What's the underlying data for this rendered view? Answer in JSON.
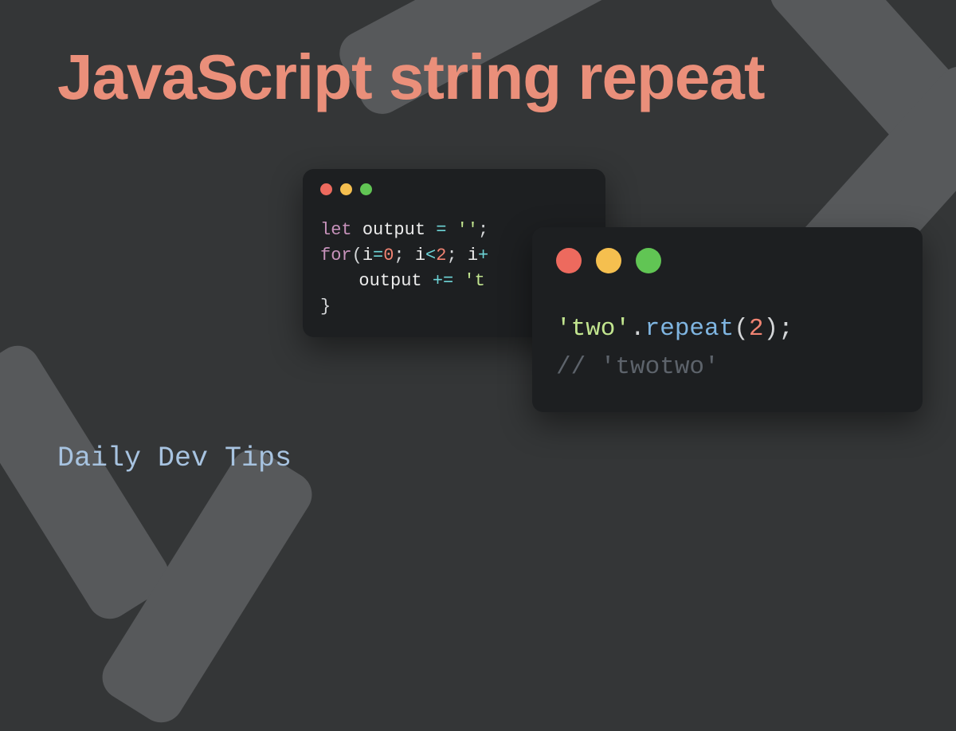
{
  "title": "JavaScript string repeat",
  "subtitle": "Daily Dev Tips",
  "colors": {
    "accent_title": "#ea8f7a",
    "subtitle": "#a7c3e0",
    "card_bg": "#1d1f21",
    "page_bg": "#343637",
    "shape_bg": "#57595b"
  },
  "traffic_dots": {
    "red": "#ed6a5e",
    "yellow": "#f5bf4f",
    "green": "#61c554"
  },
  "code_small": {
    "l1": {
      "kw": "let",
      "sp1": " ",
      "var": "output",
      "sp2": " ",
      "op": "=",
      "sp3": " ",
      "str": "''",
      "semi": ";"
    },
    "l2": {
      "kw": "for",
      "open": "(",
      "var1": "i",
      "op1": "=",
      "n1": "0",
      "semi1": ";",
      "sp1": " ",
      "var2": "i",
      "op2": "<",
      "n2": "2",
      "semi2": ";",
      "sp2": " ",
      "var3": "i",
      "tail": "+"
    },
    "l3": {
      "var": "output",
      "sp1": " ",
      "op": "+=",
      "sp2": " ",
      "str": "'t"
    },
    "l4": {
      "close": "}"
    }
  },
  "code_large": {
    "l1": {
      "str": "'two'",
      "dot": ".",
      "method": "repeat",
      "open": "(",
      "num": "2",
      "close": ")",
      "semi": ";"
    },
    "l2": {
      "comment": "// 'twotwo'"
    }
  }
}
